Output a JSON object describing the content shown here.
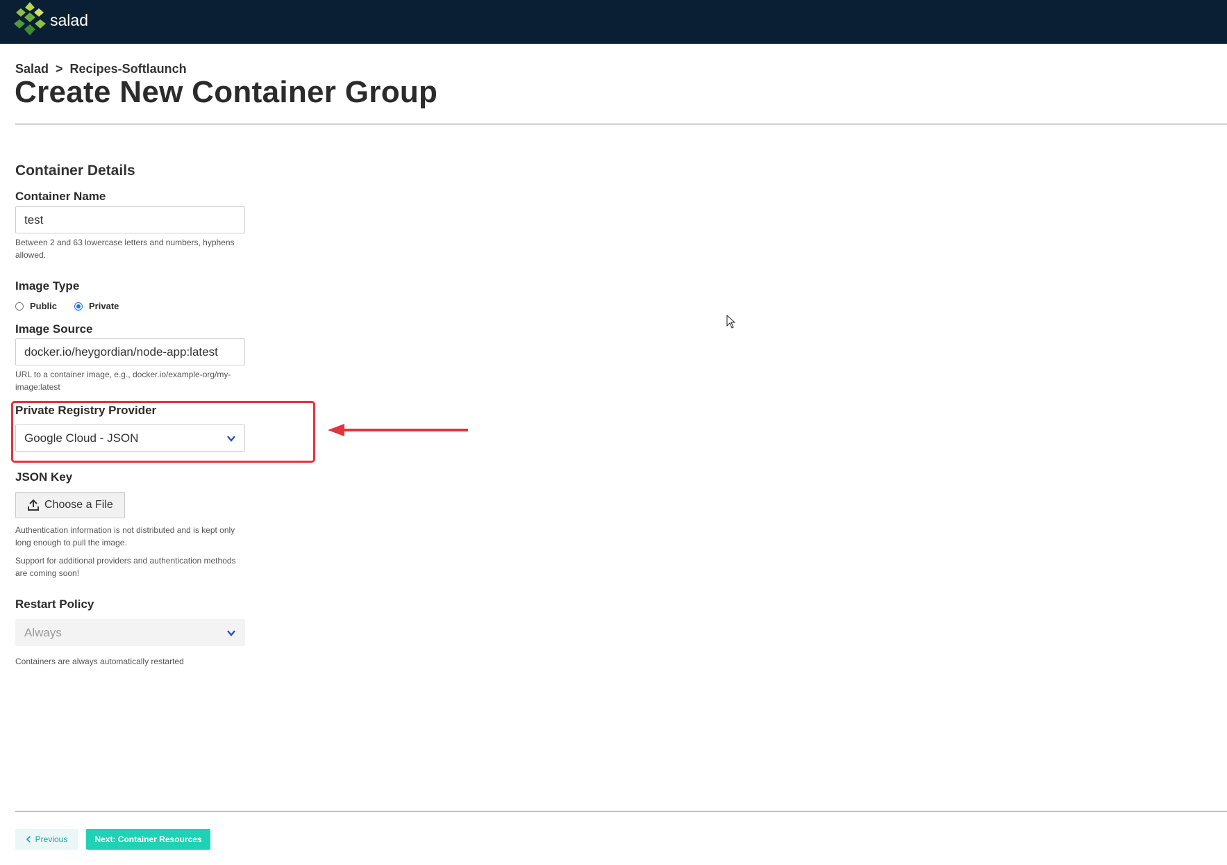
{
  "brand": {
    "name": "salad",
    "logo_icon": "salad-logo-icon"
  },
  "breadcrumb": {
    "root": "Salad",
    "separator": ">",
    "current": "Recipes-Softlaunch"
  },
  "page": {
    "title": "Create New Container Group"
  },
  "container_details": {
    "section_title": "Container Details",
    "container_name": {
      "label": "Container Name",
      "value": "test",
      "help": "Between 2 and 63 lowercase letters and numbers, hyphens allowed."
    },
    "image_type": {
      "label": "Image Type",
      "options": [
        "Public",
        "Private"
      ],
      "selected": "Private"
    },
    "image_source": {
      "label": "Image Source",
      "value": "docker.io/heygordian/node-app:latest",
      "help": "URL to a container image, e.g., docker.io/example-org/my-image:latest"
    },
    "private_registry_provider": {
      "label": "Private Registry Provider",
      "selected": "Google Cloud - JSON",
      "arrow_icon": "chevron-down-icon"
    },
    "json_key": {
      "label": "JSON Key",
      "button_label": "Choose a File",
      "button_icon": "upload-icon",
      "help_1": "Authentication information is not distributed and is kept only long enough to pull the image.",
      "help_2": "Support for additional providers and authentication methods are coming soon!"
    },
    "restart_policy": {
      "label": "Restart Policy",
      "selected": "Always",
      "help": "Containers are always automatically restarted"
    }
  },
  "footer": {
    "previous_label": "Previous",
    "next_label": "Next: Container Resources"
  },
  "colors": {
    "topbar": "#0a1f33",
    "accent": "#21d1b5",
    "highlight": "#e0343f",
    "radio_selected": "#1a73e8"
  }
}
